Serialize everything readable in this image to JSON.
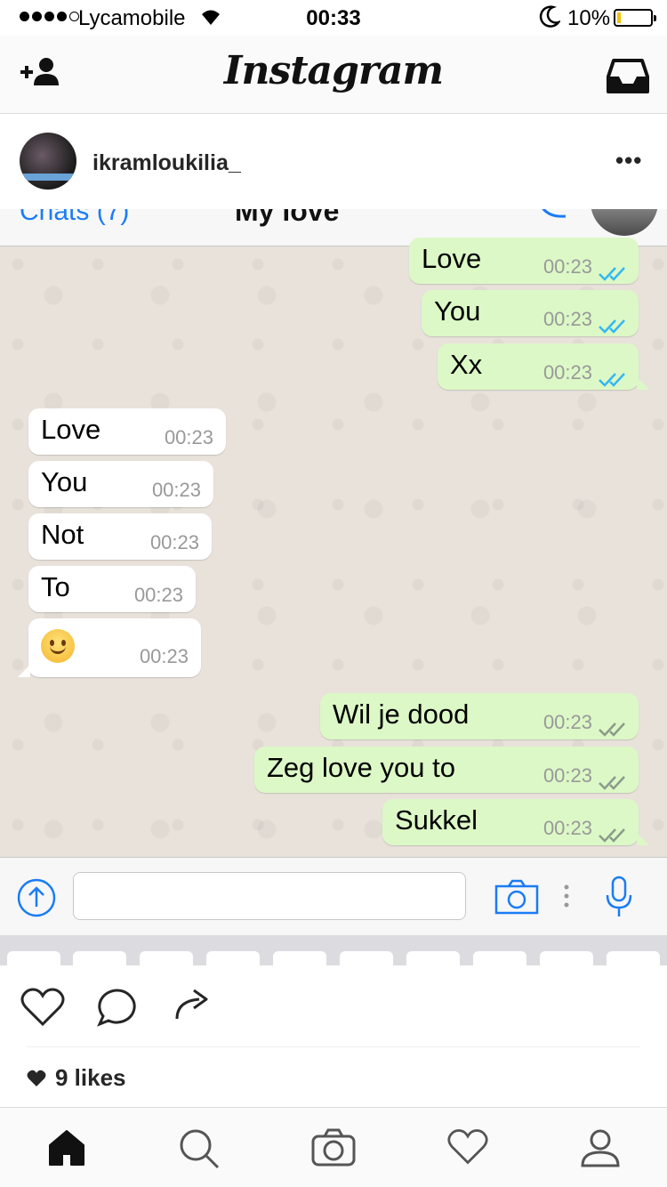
{
  "status_bar": {
    "carrier": "Lycamobile",
    "time": "00:33",
    "battery_pct": "10%",
    "battery_level": 0.1,
    "icons": [
      "signal-dots",
      "wifi-icon",
      "moon-icon",
      "battery-icon"
    ]
  },
  "header": {
    "logo": "Instagram",
    "left_icon": "add-user-icon",
    "right_icon": "inbox-icon"
  },
  "post": {
    "username": "ikramloukilia_",
    "more": "•••",
    "likes": "9 likes"
  },
  "screenshot": {
    "nav_back": "Chats (7)",
    "nav_title": "My love",
    "messages": [
      {
        "dir": "out",
        "text": "Love",
        "time": "00:23",
        "ticks": "read"
      },
      {
        "dir": "out",
        "text": "You",
        "time": "00:23",
        "ticks": "read"
      },
      {
        "dir": "out",
        "text": "Xx",
        "time": "00:23",
        "ticks": "read"
      },
      {
        "dir": "in",
        "text": "Love",
        "time": "00:23"
      },
      {
        "dir": "in",
        "text": "You",
        "time": "00:23"
      },
      {
        "dir": "in",
        "text": "Not",
        "time": "00:23"
      },
      {
        "dir": "in",
        "text": "To",
        "time": "00:23"
      },
      {
        "dir": "in",
        "text": "",
        "emoji": "smiling-face-icon",
        "time": "00:23"
      },
      {
        "dir": "out",
        "text": "Wil je dood",
        "time": "00:23",
        "ticks": "delivered"
      },
      {
        "dir": "out",
        "text": "Zeg love you to",
        "time": "00:23",
        "ticks": "delivered"
      },
      {
        "dir": "out",
        "text": "Sukkel",
        "time": "00:23",
        "ticks": "delivered"
      }
    ]
  },
  "colors": {
    "outgoing_bubble": "#dcf8c6",
    "incoming_bubble": "#ffffff",
    "read_ticks": "#34b7f1",
    "wa_blue": "#1a7cf5"
  },
  "tabbar": [
    "home-icon",
    "search-icon",
    "camera-icon",
    "heart-icon",
    "profile-icon"
  ]
}
